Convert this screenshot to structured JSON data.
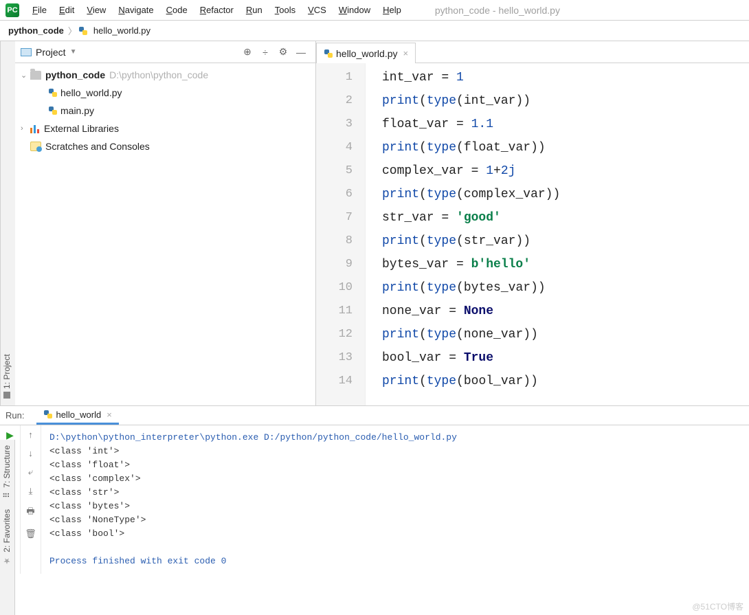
{
  "menubar": {
    "items": [
      "File",
      "Edit",
      "View",
      "Navigate",
      "Code",
      "Refactor",
      "Run",
      "Tools",
      "VCS",
      "Window",
      "Help"
    ],
    "window_title": "python_code - hello_world.py"
  },
  "breadcrumb": {
    "project": "python_code",
    "file": "hello_world.py"
  },
  "project_panel": {
    "title": "Project",
    "root": {
      "name": "python_code",
      "path": "D:\\python\\python_code"
    },
    "files": [
      "hello_world.py",
      "main.py"
    ],
    "external": "External Libraries",
    "scratches": "Scratches and Consoles"
  },
  "editor": {
    "tab_name": "hello_world.py",
    "lines": [
      [
        {
          "t": "int_var = ",
          "c": ""
        },
        {
          "t": "1",
          "c": "k-num"
        }
      ],
      [
        {
          "t": "print",
          "c": "k-fn"
        },
        {
          "t": "(",
          "c": ""
        },
        {
          "t": "type",
          "c": "k-fn"
        },
        {
          "t": "(int_var))",
          "c": ""
        }
      ],
      [
        {
          "t": "float_var = ",
          "c": ""
        },
        {
          "t": "1.1",
          "c": "k-num"
        }
      ],
      [
        {
          "t": "print",
          "c": "k-fn"
        },
        {
          "t": "(",
          "c": ""
        },
        {
          "t": "type",
          "c": "k-fn"
        },
        {
          "t": "(float_var))",
          "c": ""
        }
      ],
      [
        {
          "t": "complex_var = ",
          "c": ""
        },
        {
          "t": "1",
          "c": "k-num"
        },
        {
          "t": "+",
          "c": ""
        },
        {
          "t": "2j",
          "c": "k-num"
        }
      ],
      [
        {
          "t": "print",
          "c": "k-fn"
        },
        {
          "t": "(",
          "c": ""
        },
        {
          "t": "type",
          "c": "k-fn"
        },
        {
          "t": "(complex_var))",
          "c": ""
        }
      ],
      [
        {
          "t": "str_var = ",
          "c": ""
        },
        {
          "t": "'good'",
          "c": "k-str"
        }
      ],
      [
        {
          "t": "print",
          "c": "k-fn"
        },
        {
          "t": "(",
          "c": ""
        },
        {
          "t": "type",
          "c": "k-fn"
        },
        {
          "t": "(str_var))",
          "c": ""
        }
      ],
      [
        {
          "t": "bytes_var = ",
          "c": ""
        },
        {
          "t": "b'hello'",
          "c": "k-str"
        }
      ],
      [
        {
          "t": "print",
          "c": "k-fn"
        },
        {
          "t": "(",
          "c": ""
        },
        {
          "t": "type",
          "c": "k-fn"
        },
        {
          "t": "(bytes_var))",
          "c": ""
        }
      ],
      [
        {
          "t": "none_var = ",
          "c": ""
        },
        {
          "t": "None",
          "c": "k-kw"
        }
      ],
      [
        {
          "t": "print",
          "c": "k-fn"
        },
        {
          "t": "(",
          "c": ""
        },
        {
          "t": "type",
          "c": "k-fn"
        },
        {
          "t": "(none_var))",
          "c": ""
        }
      ],
      [
        {
          "t": "bool_var = ",
          "c": ""
        },
        {
          "t": "True",
          "c": "k-kw"
        }
      ],
      [
        {
          "t": "print",
          "c": "k-fn"
        },
        {
          "t": "(",
          "c": ""
        },
        {
          "t": "type",
          "c": "k-fn"
        },
        {
          "t": "(bool_var))",
          "c": ""
        }
      ]
    ]
  },
  "run": {
    "label": "Run:",
    "tab": "hello_world",
    "command": "D:\\python\\python_interpreter\\python.exe D:/python/python_code/hello_world.py",
    "output": [
      "<class 'int'>",
      "<class 'float'>",
      "<class 'complex'>",
      "<class 'str'>",
      "<class 'bytes'>",
      "<class 'NoneType'>",
      "<class 'bool'>"
    ],
    "exit": "Process finished with exit code 0"
  },
  "left_rail": {
    "project": "1: Project"
  },
  "side_tabs": {
    "structure": "7: Structure",
    "favorites": "2: Favorites"
  },
  "watermark": "@51CTO博客"
}
